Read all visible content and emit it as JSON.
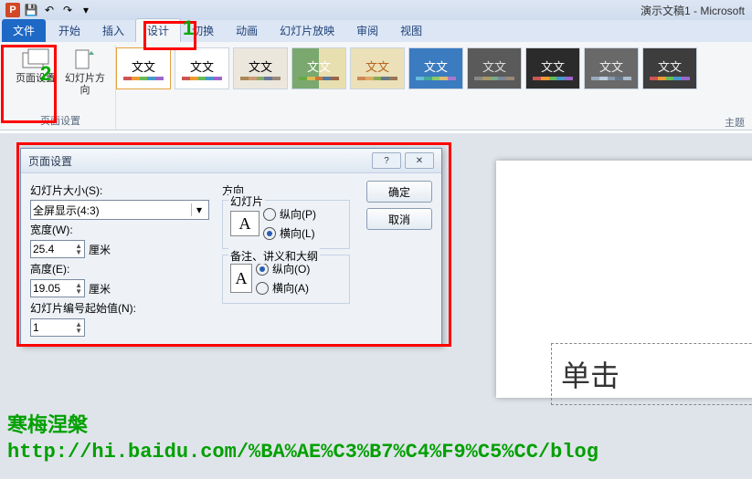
{
  "window": {
    "title": "演示文稿1 - Microsoft"
  },
  "tabs": {
    "file": "文件",
    "home": "开始",
    "insert": "插入",
    "design": "设计",
    "trans": "切换",
    "anim": "动画",
    "slideshow": "幻灯片放映",
    "review": "审阅",
    "view": "视图"
  },
  "ribbon": {
    "page_setup_btn": "页面设置",
    "orientation_btn": "幻灯片方向",
    "group_page_setup": "页面设置",
    "group_themes": "主题",
    "theme_text": "文文"
  },
  "dialog": {
    "title": "页面设置",
    "slide_size_label": "幻灯片大小(S):",
    "slide_size_value": "全屏显示(4:3)",
    "width_label": "宽度(W):",
    "width_value": "25.4",
    "width_unit": "厘米",
    "height_label": "高度(E):",
    "height_value": "19.05",
    "height_unit": "厘米",
    "number_label": "幻灯片编号起始值(N):",
    "number_value": "1",
    "direction_label": "方向",
    "slides_label": "幻灯片",
    "portrait_p": "纵向(P)",
    "landscape_l": "横向(L)",
    "notes_label": "备注、讲义和大纲",
    "portrait_o": "纵向(O)",
    "landscape_a": "横向(A)",
    "ok": "确定",
    "cancel": "取消"
  },
  "slide": {
    "placeholder": "单击"
  },
  "anno": {
    "n1": "1",
    "n2": "2"
  },
  "watermark": {
    "name": "寒梅涅槃",
    "url": "http://hi.baidu.com/%BA%AE%C3%B7%C4%F9%C5%CC/blog"
  }
}
